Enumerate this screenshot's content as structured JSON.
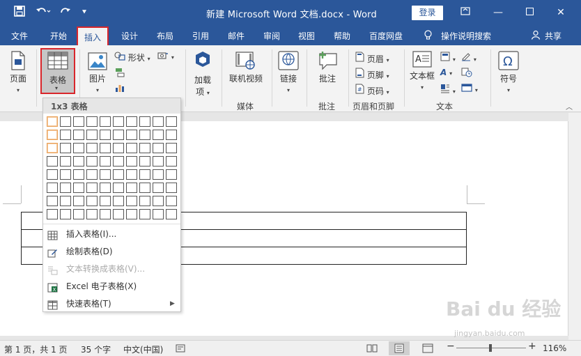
{
  "titlebar": {
    "doc_title": "新建 Microsoft Word 文档.docx  -  Word",
    "login_label": "登录"
  },
  "menu": {
    "tabs": [
      "文件",
      "开始",
      "插入",
      "设计",
      "布局",
      "引用",
      "邮件",
      "审阅",
      "视图",
      "帮助",
      "百度网盘",
      "操作说明搜索",
      "共享"
    ]
  },
  "ribbon": {
    "page": "页面",
    "table": "表格",
    "picture": "图片",
    "shapes": "形状",
    "addins_1": "加载",
    "addins_2": "项",
    "online_video": "联机视频",
    "media_group": "媒体",
    "link": "链接",
    "comment": "批注",
    "comment_group": "批注",
    "header": "页眉",
    "footer": "页脚",
    "page_number": "页码",
    "header_footer_group": "页眉和页脚",
    "textbox": "文本框",
    "text_group": "文本",
    "symbol": "符号"
  },
  "dropdown": {
    "header": "1x3 表格",
    "grid_cols": 10,
    "grid_rows": 8,
    "highlight_cols": 1,
    "highlight_rows": 3,
    "items": [
      {
        "label": "插入表格(I)...",
        "enabled": true
      },
      {
        "label": "绘制表格(D)",
        "enabled": true
      },
      {
        "label": "文本转换成表格(V)...",
        "enabled": false
      },
      {
        "label": "Excel 电子表格(X)",
        "enabled": true
      },
      {
        "label": "快速表格(T)",
        "enabled": true
      }
    ]
  },
  "statusbar": {
    "page_info": "第 1 页，共 1 页",
    "word_count": "35 个字",
    "language": "中文(中国)",
    "zoom": "116%"
  },
  "watermark": {
    "brand": "Bai du 经验",
    "url": "jingyan.baidu.com"
  },
  "colors": {
    "title_blue": "#2b579a",
    "highlight_red": "#d9262b",
    "grid_orange": "#e8a15a"
  }
}
